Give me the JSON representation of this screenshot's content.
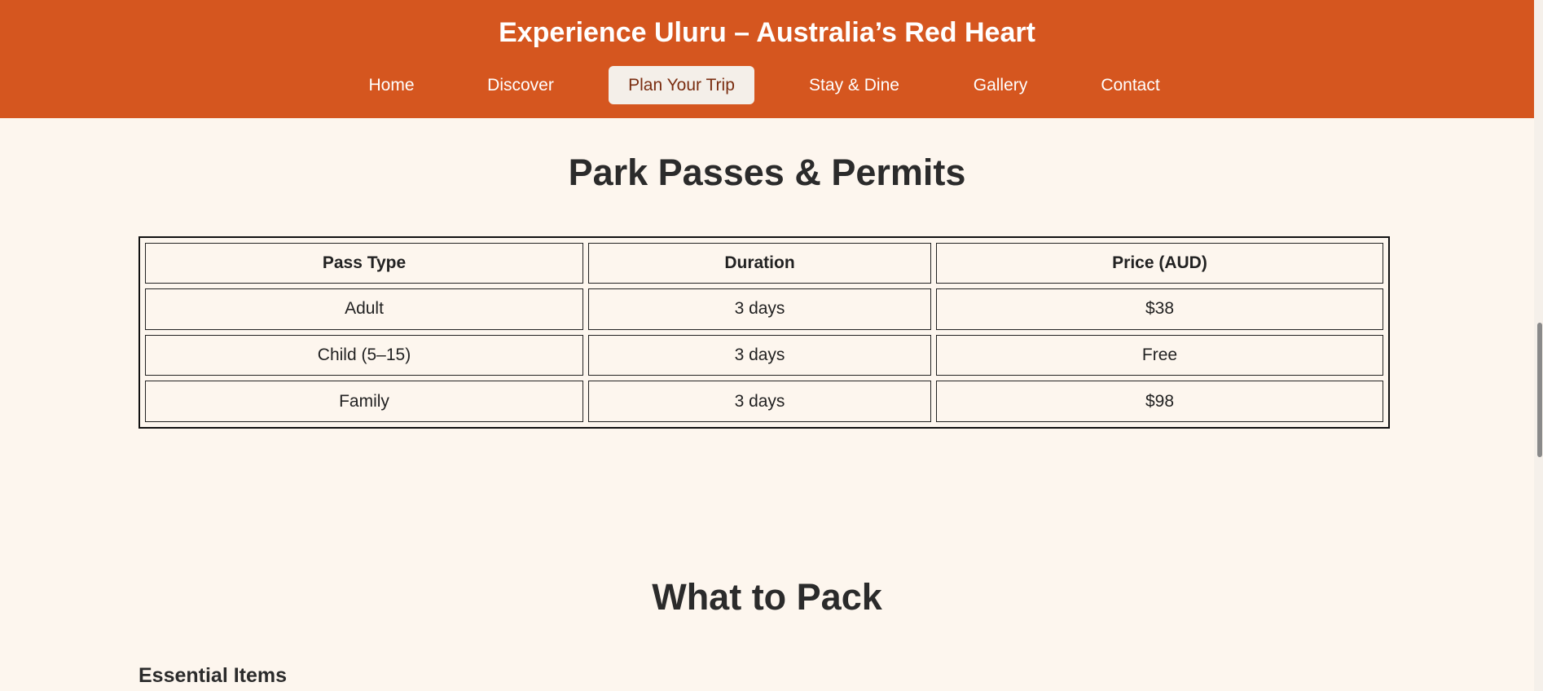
{
  "header": {
    "title": "Experience Uluru – Australia’s Red Heart",
    "background_color": "#d5561f"
  },
  "nav": {
    "items": [
      {
        "label": "Home",
        "active": false
      },
      {
        "label": "Discover",
        "active": false
      },
      {
        "label": "Plan Your Trip",
        "active": true
      },
      {
        "label": "Stay & Dine",
        "active": false
      },
      {
        "label": "Gallery",
        "active": false
      },
      {
        "label": "Contact",
        "active": false
      }
    ]
  },
  "passes": {
    "heading": "Park Passes & Permits",
    "columns": [
      "Pass Type",
      "Duration",
      "Price (AUD)"
    ],
    "rows": [
      [
        "Adult",
        "3 days",
        "$38"
      ],
      [
        "Child (5–15)",
        "3 days",
        "Free"
      ],
      [
        "Family",
        "3 days",
        "$98"
      ]
    ]
  },
  "packing": {
    "heading": "What to Pack",
    "subheading": "Essential Items"
  },
  "colors": {
    "page_background": "#fdf6ee",
    "active_nav_background": "#f4efe9",
    "text": "#2b2b2b"
  }
}
